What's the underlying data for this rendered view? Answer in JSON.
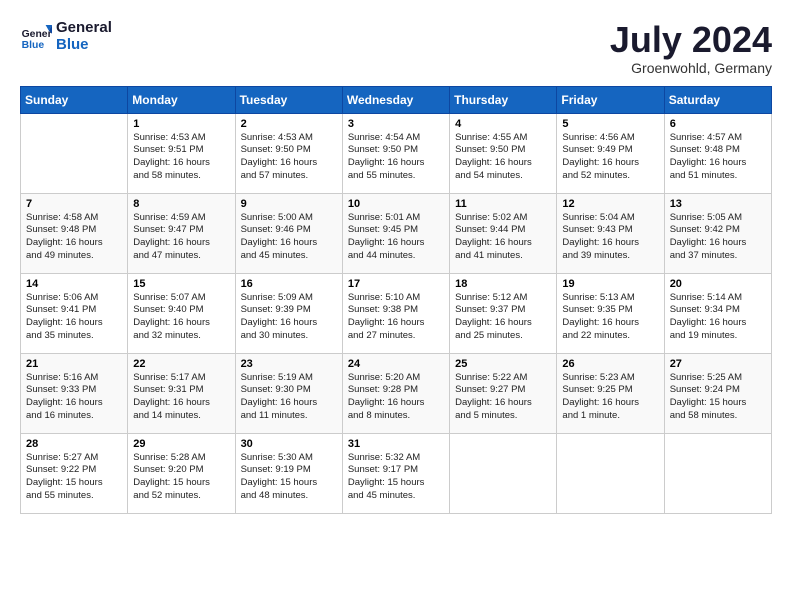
{
  "header": {
    "logo_line1": "General",
    "logo_line2": "Blue",
    "month_year": "July 2024",
    "location": "Groenwohld, Germany"
  },
  "days_of_week": [
    "Sunday",
    "Monday",
    "Tuesday",
    "Wednesday",
    "Thursday",
    "Friday",
    "Saturday"
  ],
  "weeks": [
    [
      {
        "day": "",
        "info": ""
      },
      {
        "day": "1",
        "info": "Sunrise: 4:53 AM\nSunset: 9:51 PM\nDaylight: 16 hours\nand 58 minutes."
      },
      {
        "day": "2",
        "info": "Sunrise: 4:53 AM\nSunset: 9:50 PM\nDaylight: 16 hours\nand 57 minutes."
      },
      {
        "day": "3",
        "info": "Sunrise: 4:54 AM\nSunset: 9:50 PM\nDaylight: 16 hours\nand 55 minutes."
      },
      {
        "day": "4",
        "info": "Sunrise: 4:55 AM\nSunset: 9:50 PM\nDaylight: 16 hours\nand 54 minutes."
      },
      {
        "day": "5",
        "info": "Sunrise: 4:56 AM\nSunset: 9:49 PM\nDaylight: 16 hours\nand 52 minutes."
      },
      {
        "day": "6",
        "info": "Sunrise: 4:57 AM\nSunset: 9:48 PM\nDaylight: 16 hours\nand 51 minutes."
      }
    ],
    [
      {
        "day": "7",
        "info": "Sunrise: 4:58 AM\nSunset: 9:48 PM\nDaylight: 16 hours\nand 49 minutes."
      },
      {
        "day": "8",
        "info": "Sunrise: 4:59 AM\nSunset: 9:47 PM\nDaylight: 16 hours\nand 47 minutes."
      },
      {
        "day": "9",
        "info": "Sunrise: 5:00 AM\nSunset: 9:46 PM\nDaylight: 16 hours\nand 45 minutes."
      },
      {
        "day": "10",
        "info": "Sunrise: 5:01 AM\nSunset: 9:45 PM\nDaylight: 16 hours\nand 44 minutes."
      },
      {
        "day": "11",
        "info": "Sunrise: 5:02 AM\nSunset: 9:44 PM\nDaylight: 16 hours\nand 41 minutes."
      },
      {
        "day": "12",
        "info": "Sunrise: 5:04 AM\nSunset: 9:43 PM\nDaylight: 16 hours\nand 39 minutes."
      },
      {
        "day": "13",
        "info": "Sunrise: 5:05 AM\nSunset: 9:42 PM\nDaylight: 16 hours\nand 37 minutes."
      }
    ],
    [
      {
        "day": "14",
        "info": "Sunrise: 5:06 AM\nSunset: 9:41 PM\nDaylight: 16 hours\nand 35 minutes."
      },
      {
        "day": "15",
        "info": "Sunrise: 5:07 AM\nSunset: 9:40 PM\nDaylight: 16 hours\nand 32 minutes."
      },
      {
        "day": "16",
        "info": "Sunrise: 5:09 AM\nSunset: 9:39 PM\nDaylight: 16 hours\nand 30 minutes."
      },
      {
        "day": "17",
        "info": "Sunrise: 5:10 AM\nSunset: 9:38 PM\nDaylight: 16 hours\nand 27 minutes."
      },
      {
        "day": "18",
        "info": "Sunrise: 5:12 AM\nSunset: 9:37 PM\nDaylight: 16 hours\nand 25 minutes."
      },
      {
        "day": "19",
        "info": "Sunrise: 5:13 AM\nSunset: 9:35 PM\nDaylight: 16 hours\nand 22 minutes."
      },
      {
        "day": "20",
        "info": "Sunrise: 5:14 AM\nSunset: 9:34 PM\nDaylight: 16 hours\nand 19 minutes."
      }
    ],
    [
      {
        "day": "21",
        "info": "Sunrise: 5:16 AM\nSunset: 9:33 PM\nDaylight: 16 hours\nand 16 minutes."
      },
      {
        "day": "22",
        "info": "Sunrise: 5:17 AM\nSunset: 9:31 PM\nDaylight: 16 hours\nand 14 minutes."
      },
      {
        "day": "23",
        "info": "Sunrise: 5:19 AM\nSunset: 9:30 PM\nDaylight: 16 hours\nand 11 minutes."
      },
      {
        "day": "24",
        "info": "Sunrise: 5:20 AM\nSunset: 9:28 PM\nDaylight: 16 hours\nand 8 minutes."
      },
      {
        "day": "25",
        "info": "Sunrise: 5:22 AM\nSunset: 9:27 PM\nDaylight: 16 hours\nand 5 minutes."
      },
      {
        "day": "26",
        "info": "Sunrise: 5:23 AM\nSunset: 9:25 PM\nDaylight: 16 hours\nand 1 minute."
      },
      {
        "day": "27",
        "info": "Sunrise: 5:25 AM\nSunset: 9:24 PM\nDaylight: 15 hours\nand 58 minutes."
      }
    ],
    [
      {
        "day": "28",
        "info": "Sunrise: 5:27 AM\nSunset: 9:22 PM\nDaylight: 15 hours\nand 55 minutes."
      },
      {
        "day": "29",
        "info": "Sunrise: 5:28 AM\nSunset: 9:20 PM\nDaylight: 15 hours\nand 52 minutes."
      },
      {
        "day": "30",
        "info": "Sunrise: 5:30 AM\nSunset: 9:19 PM\nDaylight: 15 hours\nand 48 minutes."
      },
      {
        "day": "31",
        "info": "Sunrise: 5:32 AM\nSunset: 9:17 PM\nDaylight: 15 hours\nand 45 minutes."
      },
      {
        "day": "",
        "info": ""
      },
      {
        "day": "",
        "info": ""
      },
      {
        "day": "",
        "info": ""
      }
    ]
  ]
}
